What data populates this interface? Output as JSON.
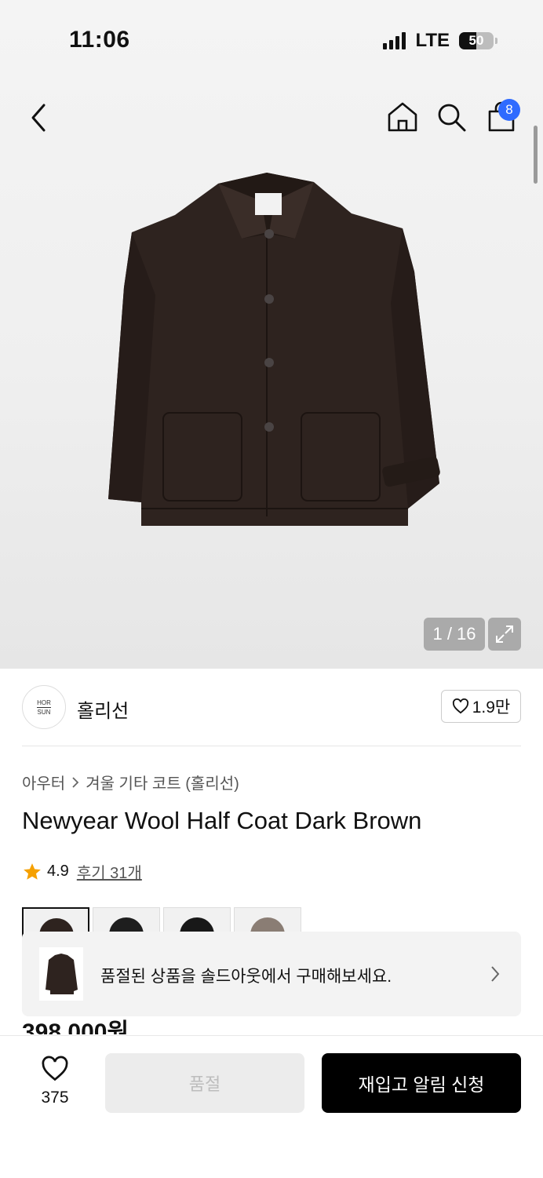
{
  "status_bar": {
    "time": "11:06",
    "network": "LTE",
    "battery": "50",
    "battery_level": 0.5
  },
  "header": {
    "cart_badge": "8"
  },
  "gallery": {
    "counter": "1 / 16"
  },
  "brand": {
    "logo_line1": "HOR",
    "logo_line2": "SUN",
    "name": "홀리선",
    "likes": "1.9만"
  },
  "breadcrumb": {
    "category": "아우터",
    "subcategory": "겨울 기타 코트 (홀리선)"
  },
  "product": {
    "title": "Newyear Wool Half Coat Dark Brown",
    "rating": "4.9",
    "reviews": "후기 31개",
    "price": "398,000원"
  },
  "soldout_banner": {
    "message": "품절된 상품을 솔드아웃에서 구매해보세요."
  },
  "bottom_bar": {
    "wish_count": "375",
    "soldout_label": "품절",
    "restock_label": "재입고 알림 신청"
  },
  "colors": {
    "accent": "#2f6bff",
    "star": "#f5a000",
    "coat": "#2e231f"
  }
}
